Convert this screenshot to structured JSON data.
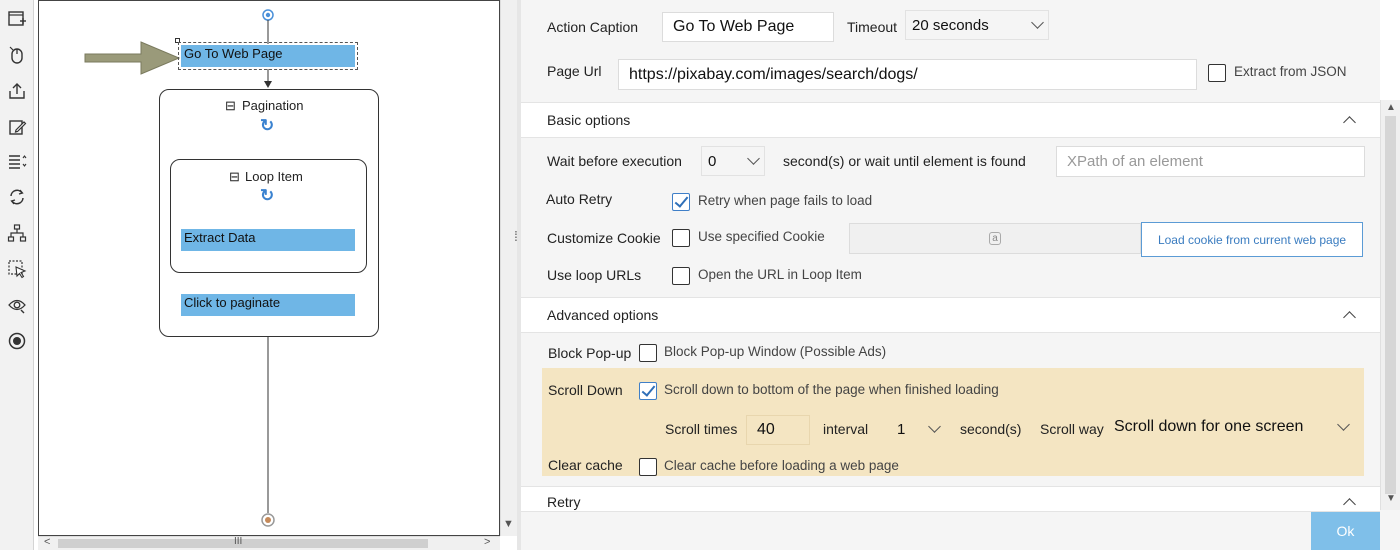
{
  "toolbar": {
    "icons": [
      "new-task-icon",
      "mouse-click-icon",
      "export-icon",
      "edit-icon",
      "list-icon",
      "refresh-icon",
      "sitemap-icon",
      "select-element-icon",
      "settings-eye-icon",
      "record-icon"
    ]
  },
  "workflow": {
    "steps": {
      "go_to_web_page": "Go To Web Page",
      "extract_data": "Extract Data",
      "click_to_paginate": "Click to paginate"
    },
    "pagination_label": "Pagination",
    "loop_item_label": "Loop Item",
    "collapse_glyph": "⊟",
    "loop_glyph": "↻",
    "colors": {
      "step_fill": "#6fb6e6",
      "arrow": "#8f8f6f"
    }
  },
  "form": {
    "action_caption_label": "Action Caption",
    "action_caption_value": "Go To Web Page",
    "timeout_label": "Timeout",
    "timeout_value": "20 seconds",
    "page_url_label": "Page Url",
    "page_url_value": "https://pixabay.com/images/search/dogs/",
    "extract_json_label": "Extract from JSON"
  },
  "basic": {
    "header": "Basic options",
    "wait_label": "Wait before execution",
    "wait_value": "0",
    "wait_suffix": "second(s)  or wait until element is found",
    "xpath_placeholder": "XPath of an element",
    "auto_retry_label": "Auto Retry",
    "retry_checkbox_label": "Retry when page fails to load",
    "cookie_label": "Customize Cookie",
    "cookie_checkbox_label": "Use specified Cookie",
    "cookie_field_glyph": "a",
    "load_cookie_button": "Load cookie from current web page",
    "loop_urls_label": "Use loop URLs",
    "loop_urls_checkbox_label": "Open the URL in Loop Item"
  },
  "advanced": {
    "header": "Advanced options",
    "block_popup_label": "Block Pop-up",
    "block_popup_checkbox_label": "Block Pop-up Window (Possible Ads)",
    "scroll_down_label": "Scroll Down",
    "scroll_down_checkbox_label": "Scroll down to bottom of the page when finished loading",
    "scroll_times_label": "Scroll times",
    "scroll_times_value": "40",
    "interval_label": "interval",
    "interval_value": "1",
    "interval_suffix": "second(s)",
    "scroll_way_label": "Scroll way",
    "scroll_way_value": "Scroll down for one screen",
    "clear_cache_label": "Clear cache",
    "clear_cache_checkbox_label": "Clear cache before loading a web page"
  },
  "retry": {
    "header": "Retry"
  },
  "footer": {
    "ok_label": "Ok"
  },
  "scroll_glyphs": {
    "up": "▲",
    "down": "▼",
    "left": "<",
    "right": ">",
    "grip": "III",
    "splitter": "⁞"
  }
}
